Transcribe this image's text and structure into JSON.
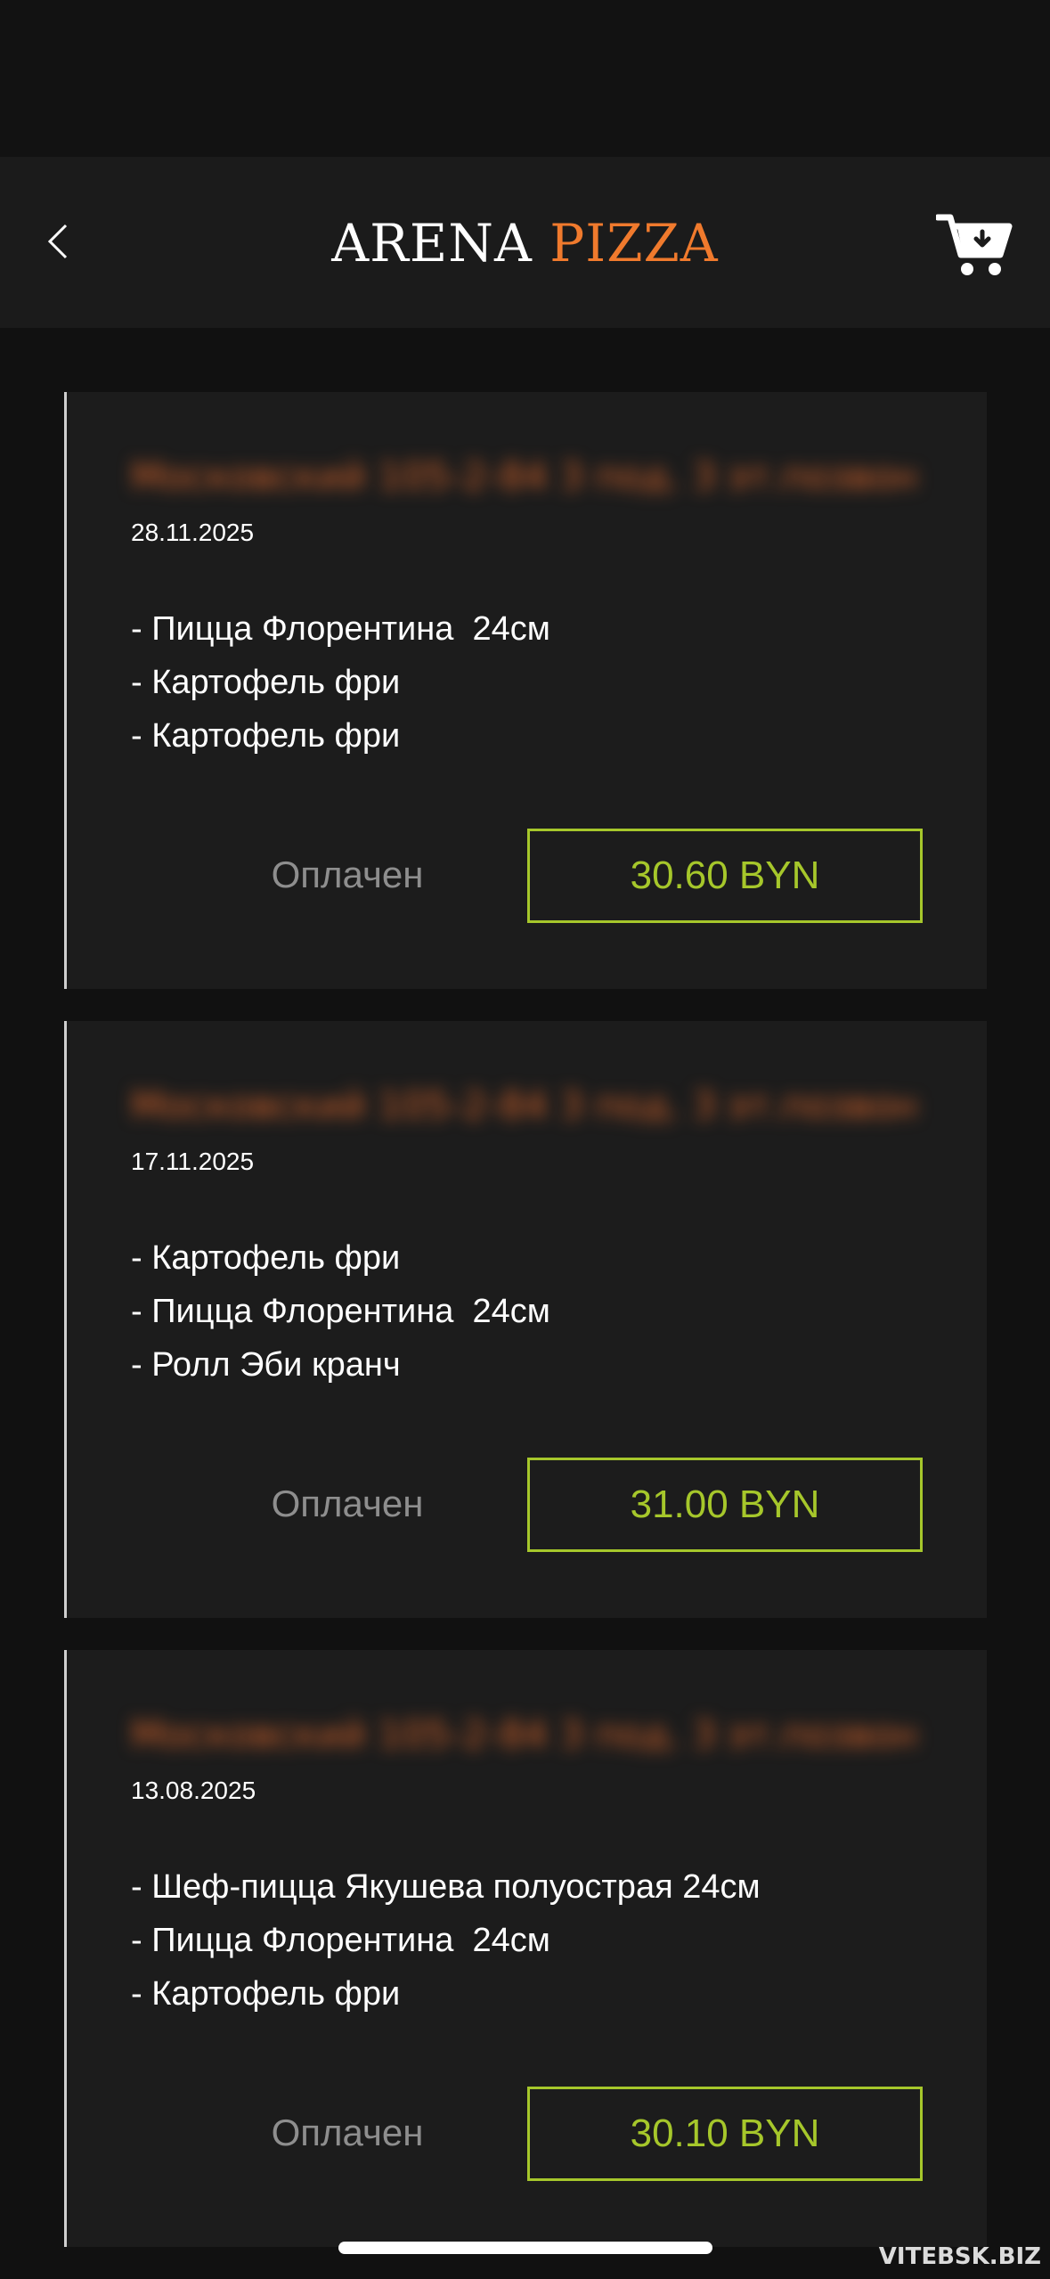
{
  "header": {
    "back_icon": "chevron-left-icon",
    "logo_word1": "ARENA",
    "logo_word2": "PIZZA",
    "cart_icon": "cart-download-icon"
  },
  "orders": [
    {
      "address": "Московский 105-2-84 3 под. 3 эт.позвон..",
      "date": "28.11.2025",
      "items": [
        "- Пицца Флорентина  24см",
        "- Картофель фри",
        "- Картофель фри"
      ],
      "status": "Оплачен",
      "total": "30.60 BYN"
    },
    {
      "address": "Московский 105-2-84 3 под. 3 эт.позвон..",
      "date": "17.11.2025",
      "items": [
        "- Картофель фри",
        "- Пицца Флорентина  24см",
        "- Ролл Эби кранч"
      ],
      "status": "Оплачен",
      "total": "31.00 BYN"
    },
    {
      "address": "Московский 105-2-84 3 под. 3 эт.позвон..",
      "date": "13.08.2025",
      "items": [
        "- Шеф-пицца Якушева полуострая 24см",
        "- Пицца Флорентина  24см",
        "- Картофель фри"
      ],
      "status": "Оплачен",
      "total": "30.10 BYN"
    }
  ],
  "watermark": "VITEBSK.BIZ",
  "colors": {
    "accent_orange": "#f07a2d",
    "accent_green": "#a6c72b",
    "background": "#111111",
    "card": "#1c1c1c"
  }
}
